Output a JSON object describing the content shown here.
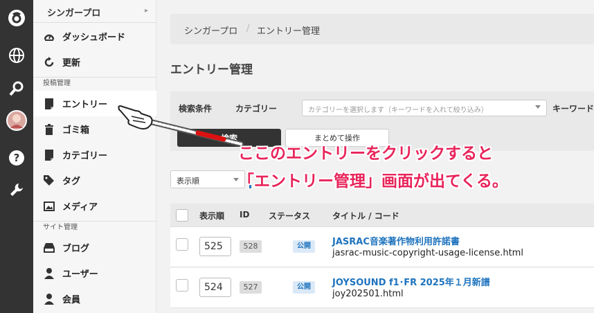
{
  "sidebar": {
    "site_title": "シンガープロ",
    "items_top": [
      {
        "label": "ダッシュボード",
        "icon": "dashboard-icon"
      },
      {
        "label": "更新",
        "icon": "refresh-icon"
      }
    ],
    "section_posts": "投稿管理",
    "items_posts": [
      {
        "label": "エントリー",
        "icon": "entry-icon"
      },
      {
        "label": "ゴミ箱",
        "icon": "trash-icon"
      },
      {
        "label": "カテゴリー",
        "icon": "category-icon"
      },
      {
        "label": "タグ",
        "icon": "tag-icon"
      },
      {
        "label": "メディア",
        "icon": "media-icon"
      }
    ],
    "section_site": "サイト管理",
    "items_site": [
      {
        "label": "ブログ",
        "icon": "blog-icon"
      },
      {
        "label": "ユーザー",
        "icon": "user-icon"
      },
      {
        "label": "会員",
        "icon": "member-icon"
      }
    ]
  },
  "breadcrumb": {
    "root": "シンガープロ",
    "separator": "/",
    "current": "エントリー管理"
  },
  "page_title": "エントリー管理",
  "filter": {
    "heading": "検索条件",
    "category_label": "カテゴリー",
    "category_placeholder": "カテゴリーを選択します（キーワードを入れて絞り込み）",
    "keyword_label": "キーワード",
    "search_button": "検索",
    "bulk_button": "まとめて操作"
  },
  "sort": {
    "selected": "表示順"
  },
  "table": {
    "headers": {
      "order": "表示順",
      "id": "ID",
      "status": "ステータス",
      "title": "タイトル / コード"
    },
    "rows": [
      {
        "order": "525",
        "id": "528",
        "status": "公開",
        "title": "JASRAC音楽著作物利用許諾書",
        "code": "jasrac-music-copyright-usage-license.html"
      },
      {
        "order": "524",
        "id": "527",
        "status": "公開",
        "title": "JOYSOUND f1･FR 2025年１月新譜",
        "code": "joy202501.html"
      }
    ]
  },
  "annotation": {
    "line1": "ここのエントリーをクリックすると",
    "line2": "「エントリー管理」画面が出てくる。"
  },
  "colors": {
    "accent": "#1e73be",
    "annotation": "#e8245a",
    "rail": "#333333"
  }
}
